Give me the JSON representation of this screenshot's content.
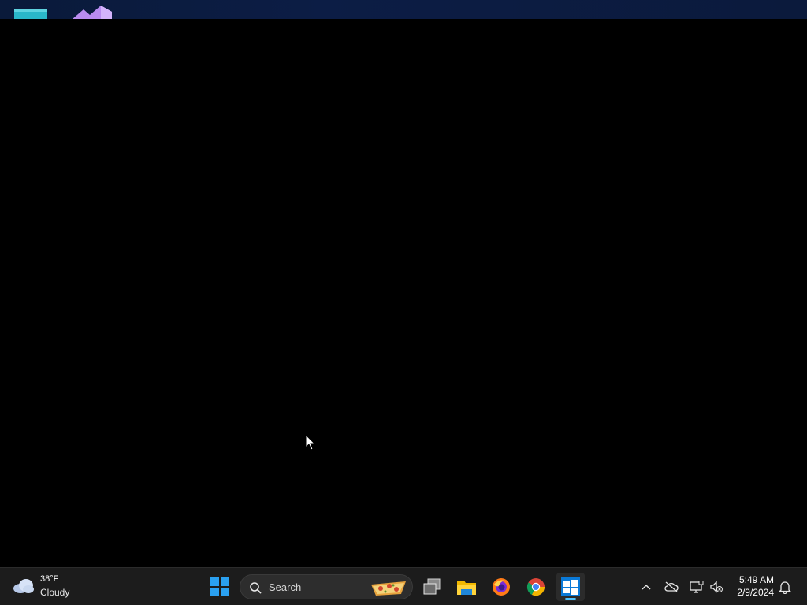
{
  "desktop": {
    "background": "#000000",
    "top_strip_color": "#0c1d45",
    "icons": [
      {
        "name": "desktop-app-icon-1",
        "color": "#2ab7c9"
      },
      {
        "name": "desktop-app-icon-2",
        "color": "#b98cf0"
      }
    ]
  },
  "taskbar": {
    "background": "#1c1c1c",
    "weather": {
      "temperature": "38°F",
      "condition": "Cloudy",
      "icon": "cloud-icon"
    },
    "start": {
      "icon": "windows-start-icon",
      "accent": "#2aa0f0"
    },
    "search": {
      "label": "Search",
      "icon": "search-icon",
      "highlight_icon": "pizza-icon"
    },
    "apps": [
      {
        "name": "task-view",
        "icon": "task-view-icon"
      },
      {
        "name": "file-explorer",
        "icon": "folder-icon"
      },
      {
        "name": "firefox",
        "icon": "firefox-icon"
      },
      {
        "name": "chrome",
        "icon": "chrome-icon"
      },
      {
        "name": "windows-app",
        "icon": "windows-app-icon",
        "active": true
      }
    ],
    "tray": {
      "overflow_icon": "chevron-up-icon",
      "icons": [
        "cloud-off-icon",
        "network-icon",
        "volume-muted-icon"
      ]
    },
    "clock": {
      "time": "5:49 AM",
      "date": "2/9/2024"
    },
    "notifications_icon": "bell-icon"
  }
}
